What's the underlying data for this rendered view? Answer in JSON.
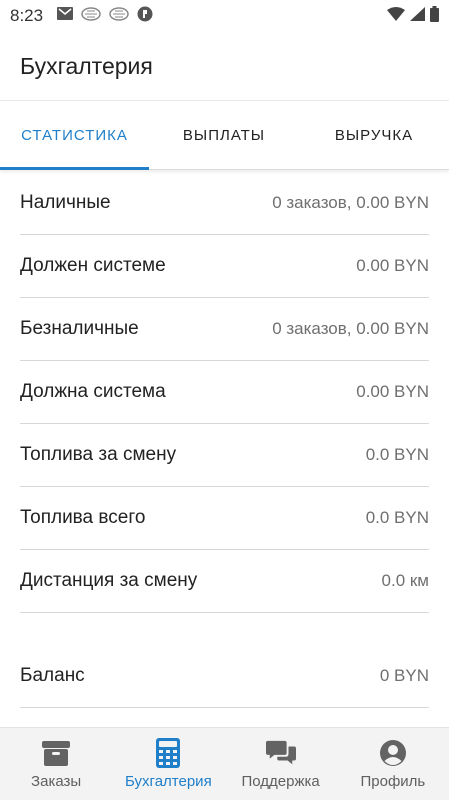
{
  "status_bar": {
    "time": "8:23"
  },
  "app_bar": {
    "title": "Бухгалтерия"
  },
  "tabs": [
    {
      "label": "СТАТИСТИКА",
      "active": true
    },
    {
      "label": "ВЫПЛАТЫ",
      "active": false
    },
    {
      "label": "ВЫРУЧКА",
      "active": false
    }
  ],
  "stats": [
    {
      "label": "Наличные",
      "value": "0 заказов, 0.00 BYN"
    },
    {
      "label": "Должен системе",
      "value": "0.00 BYN"
    },
    {
      "label": "Безналичные",
      "value": "0 заказов, 0.00 BYN"
    },
    {
      "label": "Должна система",
      "value": "0.00 BYN"
    },
    {
      "label": "Топлива за смену",
      "value": "0.0 BYN"
    },
    {
      "label": "Топлива всего",
      "value": "0.0 BYN"
    },
    {
      "label": "Дистанция за смену",
      "value": "0.0 км"
    }
  ],
  "balance": {
    "label": "Баланс",
    "value": "0 BYN"
  },
  "bottom_nav": [
    {
      "label": "Заказы",
      "icon": "box-icon",
      "active": false
    },
    {
      "label": "Бухгалтерия",
      "icon": "calculator-icon",
      "active": true
    },
    {
      "label": "Поддержка",
      "icon": "chat-bubbles-icon",
      "active": false
    },
    {
      "label": "Профиль",
      "icon": "account-icon",
      "active": false
    }
  ],
  "colors": {
    "accent": "#1f7fc9",
    "divider": "#d8d8d8",
    "nav_background": "#f3f3f3"
  }
}
